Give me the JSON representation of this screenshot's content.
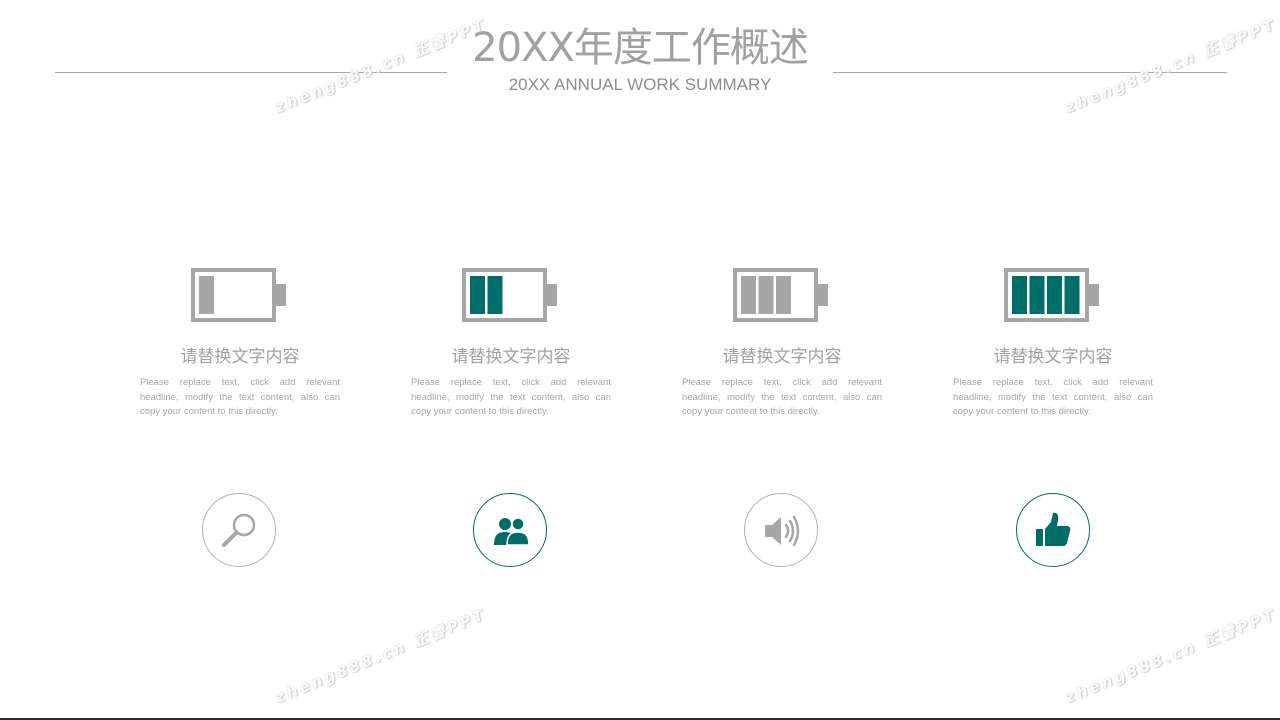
{
  "header": {
    "title": "20XX年度工作概述",
    "subtitle": "20XX ANNUAL WORK SUMMARY"
  },
  "columns": [
    {
      "battery_level": 0.25,
      "battery_color": "#a6a6a6",
      "heading": "请替换文字内容",
      "description": "Please replace text, click add relevant headline, modify the text content, also can copy your content to this directly."
    },
    {
      "battery_level": 0.5,
      "battery_color": "#006e68",
      "heading": "请替换文字内容",
      "description": "Please replace text, click add relevant headline, modify the text content, also can copy your content to this directly."
    },
    {
      "battery_level": 0.75,
      "battery_color": "#a6a6a6",
      "heading": "请替换文字内容",
      "description": "Please replace text, click add relevant headline, modify the text content, also can copy your content to this directly."
    },
    {
      "battery_level": 1.0,
      "battery_color": "#006e68",
      "heading": "请替换文字内容",
      "description": "Please replace text, click add relevant headline, modify the text content, also can copy your content to this directly."
    }
  ],
  "icons": [
    {
      "name": "magnifier-icon",
      "color": "#a6a6a6"
    },
    {
      "name": "users-icon",
      "color": "#006e68"
    },
    {
      "name": "speaker-icon",
      "color": "#a6a6a6"
    },
    {
      "name": "thumbs-up-icon",
      "color": "#006e68"
    }
  ],
  "watermark": {
    "text": "zheng888.cn 正睿PPT"
  },
  "colors": {
    "accent": "#006e68",
    "gray": "#a6a6a6"
  }
}
